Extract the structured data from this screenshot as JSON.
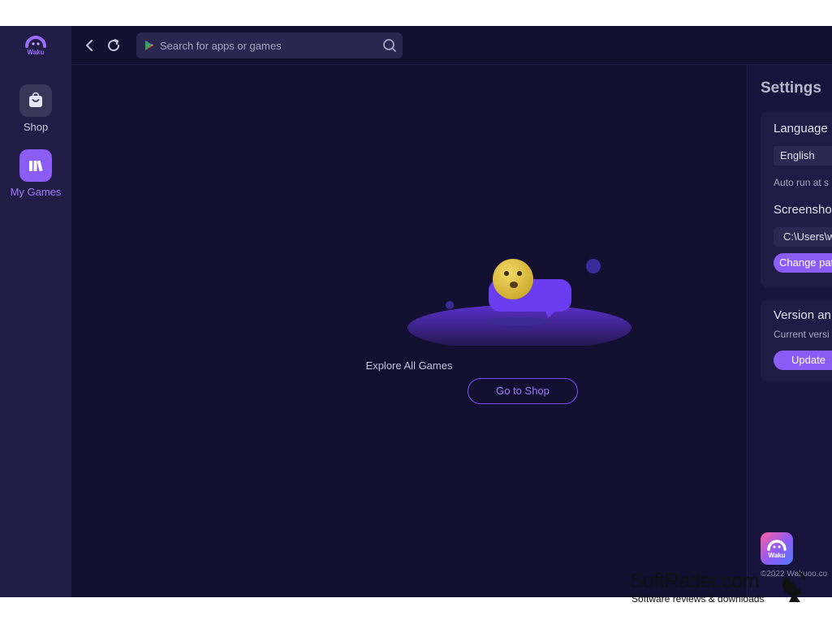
{
  "rail": {
    "logo_text": "Waku",
    "items": [
      {
        "label": "Shop",
        "icon": "shopping-bag-icon",
        "active": false
      },
      {
        "label": "My Games",
        "icon": "game-library-icon",
        "active": true
      }
    ]
  },
  "topbar": {
    "search": {
      "placeholder": "Search for apps or games",
      "value": ""
    }
  },
  "empty_state": {
    "message": "Explore All Games",
    "button_label": "Go to Shop"
  },
  "settings": {
    "title": "Settings",
    "language": {
      "heading": "Language",
      "selected": "English",
      "auto_run_text": "Auto run at s"
    },
    "screenshot": {
      "heading": "Screenshot",
      "path": "C:\\Users\\w",
      "change_label": "Change pat"
    },
    "version": {
      "heading": "Version an",
      "current_text": "Current versi",
      "update_label": "Update"
    },
    "footer": {
      "logo_text": "Waku",
      "copyright": "©2022 Wakuoo.co"
    }
  },
  "watermark": {
    "name": "SoftRadar.com",
    "tagline": "Software reviews & downloads"
  },
  "colors": {
    "background": "#130f31",
    "rail": "#201c45",
    "accent": "#8b5cf6",
    "accent_text": "#9f7bff"
  }
}
